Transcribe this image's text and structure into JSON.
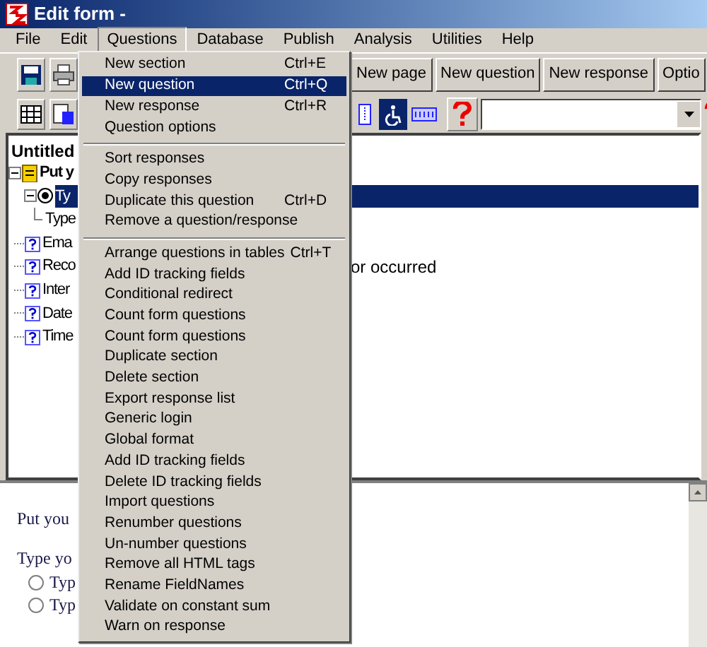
{
  "window": {
    "title": "Edit form -"
  },
  "menu_bar": [
    {
      "label": "File",
      "selected": false
    },
    {
      "label": "Edit",
      "selected": false
    },
    {
      "label": "Questions",
      "selected": true
    },
    {
      "label": "Database",
      "selected": false
    },
    {
      "label": "Publish",
      "selected": false
    },
    {
      "label": "Analysis",
      "selected": false
    },
    {
      "label": "Utilities",
      "selected": false
    },
    {
      "label": "Help",
      "selected": false
    }
  ],
  "toolbar_buttons": [
    "New page",
    "New question",
    "New response",
    "Optio"
  ],
  "questions_menu": [
    [
      {
        "label": "New section",
        "shortcut": "Ctrl+E",
        "selected": false
      },
      {
        "label": "New question",
        "shortcut": "Ctrl+Q",
        "selected": true
      },
      {
        "label": "New response",
        "shortcut": "Ctrl+R",
        "selected": false
      },
      {
        "label": "Question options",
        "selected": false
      }
    ],
    [
      {
        "label": "Sort responses",
        "selected": false
      },
      {
        "label": "Copy responses",
        "selected": false
      },
      {
        "label": "Duplicate this question",
        "shortcut": "Ctrl+D",
        "selected": false
      },
      {
        "label": "Remove a question/response",
        "selected": false
      }
    ],
    [
      {
        "label": "Arrange questions in tables",
        "shortcut": "Ctrl+T",
        "selected": false
      },
      {
        "label": "Add ID tracking fields",
        "selected": false
      },
      {
        "label": "Conditional redirect",
        "selected": false
      },
      {
        "label": "Count form questions",
        "selected": false
      },
      {
        "label": "Count form questions",
        "selected": false
      },
      {
        "label": "Duplicate section",
        "selected": false
      },
      {
        "label": "Delete section",
        "selected": false
      },
      {
        "label": "Export response list",
        "selected": false
      },
      {
        "label": "Generic login",
        "selected": false
      },
      {
        "label": "Global format",
        "selected": false
      },
      {
        "label": "Add ID tracking fields",
        "selected": false
      },
      {
        "label": "Delete ID tracking fields",
        "selected": false
      },
      {
        "label": "Import questions",
        "selected": false
      },
      {
        "label": "Renumber questions",
        "selected": false
      },
      {
        "label": "Un-number questions",
        "selected": false
      },
      {
        "label": "Remove all HTML tags",
        "selected": false
      },
      {
        "label": "Rename FieldNames",
        "selected": false
      },
      {
        "label": "Validate on constant sum",
        "selected": false
      },
      {
        "label": "Warn on response",
        "selected": false
      }
    ]
  ],
  "tree": {
    "title": "Untitled",
    "items": [
      {
        "label": "Put y",
        "kind": "section",
        "expanded": true,
        "selected": false,
        "children": [
          {
            "label": "Ty",
            "kind": "radio",
            "expanded": true,
            "selected": true,
            "children": [
              {
                "label": "Type",
                "kind": "response",
                "selected": false
              }
            ]
          },
          {
            "label": "Ema",
            "kind": "question",
            "selected": false
          },
          {
            "label": "Reco",
            "kind": "question",
            "selected": false,
            "trailing_text": "or occurred"
          },
          {
            "label": "Inter",
            "kind": "question",
            "selected": false
          },
          {
            "label": "Date",
            "kind": "question",
            "selected": false
          },
          {
            "label": "Time",
            "kind": "question",
            "selected": false
          }
        ]
      }
    ]
  },
  "preview": {
    "lines": [
      "Put you",
      "Type yo"
    ],
    "options": [
      {
        "label": "Typ",
        "checked": false
      },
      {
        "label": "Typ",
        "checked": false
      }
    ]
  }
}
